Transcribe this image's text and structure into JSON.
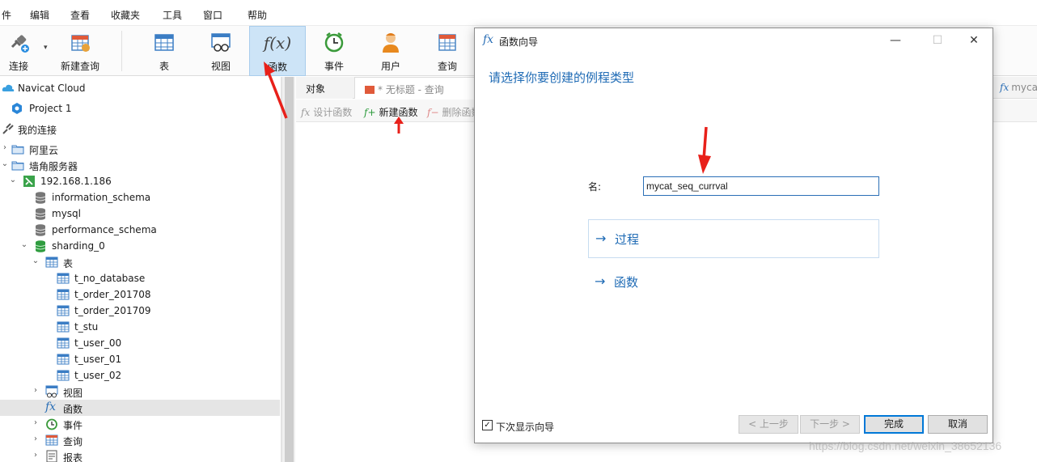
{
  "menubar": {
    "items": [
      "件",
      "编辑",
      "查看",
      "收藏夹",
      "工具",
      "窗口",
      "帮助"
    ]
  },
  "toolbar": {
    "connect": "连接",
    "new_query": "新建查询",
    "table": "表",
    "view": "视图",
    "function": "函数",
    "event": "事件",
    "user": "用户",
    "query": "查询"
  },
  "sidebar": {
    "items": [
      {
        "label": "Navicat Cloud"
      },
      {
        "label": "Project 1"
      },
      {
        "label": "我的连接"
      },
      {
        "label": "阿里云"
      },
      {
        "label": "墙角服务器"
      },
      {
        "label": "192.168.1.186"
      },
      {
        "label": "information_schema"
      },
      {
        "label": "mysql"
      },
      {
        "label": "performance_schema"
      },
      {
        "label": "sharding_0"
      },
      {
        "label": "表"
      },
      {
        "label": "t_no_database"
      },
      {
        "label": "t_order_201708"
      },
      {
        "label": "t_order_201709"
      },
      {
        "label": "t_stu"
      },
      {
        "label": "t_user_00"
      },
      {
        "label": "t_user_01"
      },
      {
        "label": "t_user_02"
      },
      {
        "label": "视图"
      },
      {
        "label": "函数"
      },
      {
        "label": "事件"
      },
      {
        "label": "查询"
      },
      {
        "label": "报表"
      }
    ]
  },
  "tabs": {
    "objects": "对象",
    "query_tab": "* 无标题 - 查询",
    "right_tab": "mycat_"
  },
  "subtoolbar": {
    "design_function": "设计函数",
    "new_function": "新建函数",
    "delete_function": "删除函数"
  },
  "dialog": {
    "title": "函数向导",
    "heading": "请选择你要创建的例程类型",
    "name_label": "名:",
    "name_value": "mycat_seq_currval",
    "option_procedure": "过程",
    "option_function": "函数",
    "show_wizard_label": "下次显示向导",
    "show_wizard_checked": true,
    "prev_button": "< 上一步",
    "next_button": "下一步 >",
    "finish_button": "完成",
    "cancel_button": "取消"
  },
  "colors": {
    "accent": "#1f6bb5",
    "active_toolbar": "#cde4f7",
    "annotation_red": "#e8201a"
  },
  "watermark": "https://blog.csdn.net/weixin_38652136"
}
